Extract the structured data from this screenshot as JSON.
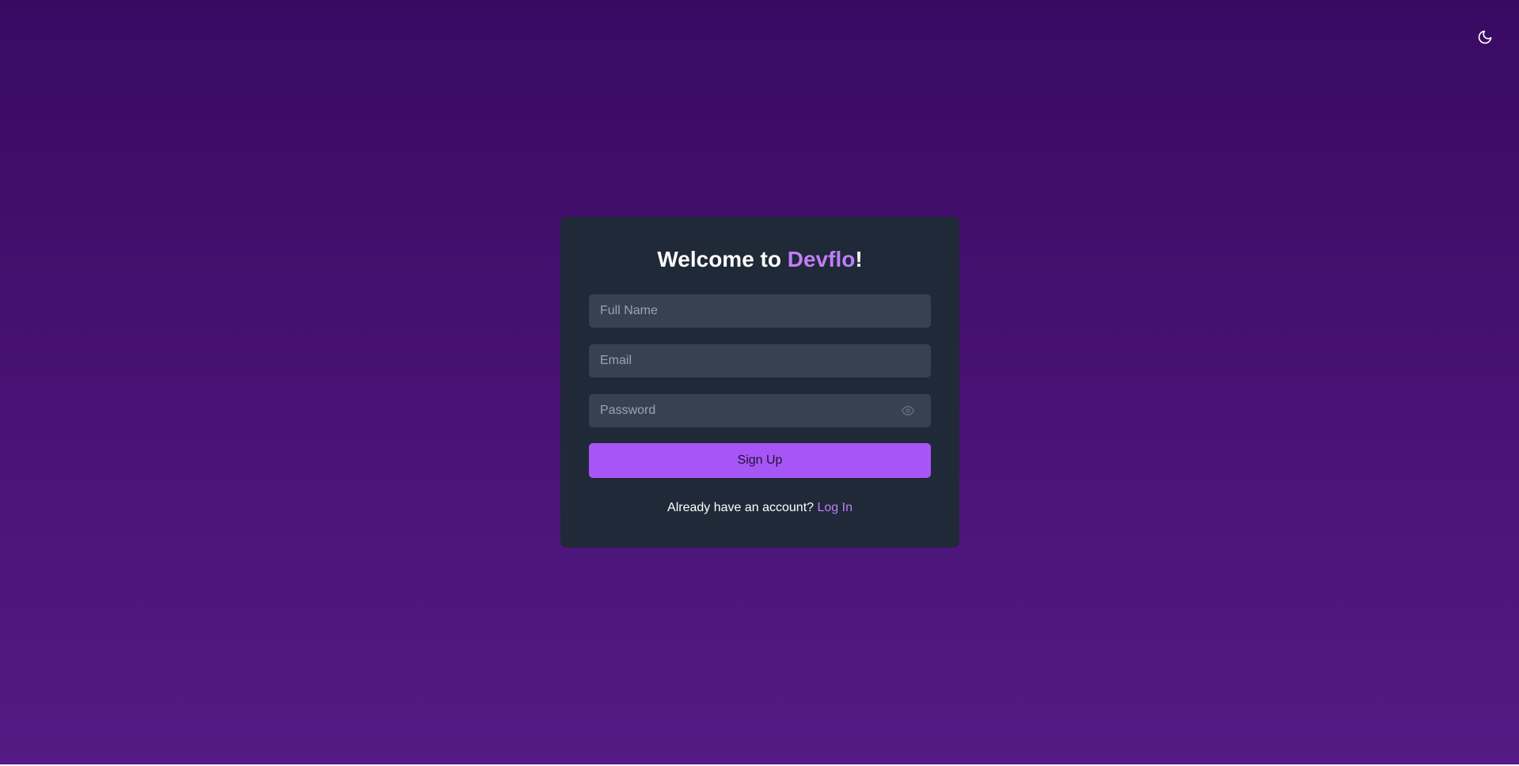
{
  "theme_toggle": {
    "icon": "moon-icon"
  },
  "signup_card": {
    "title_prefix": "Welcome to ",
    "title_brand": "Devflo",
    "title_suffix": "!",
    "full_name_placeholder": "Full Name",
    "email_placeholder": "Email",
    "password_placeholder": "Password",
    "password_toggle_icon": "eye-icon",
    "submit_label": "Sign Up",
    "footer_text": "Already have an account? ",
    "footer_link": "Log In"
  },
  "colors": {
    "background_top": "#3a0a63",
    "background_bottom": "#541a85",
    "card": "#1f2937",
    "input": "#374151",
    "accent": "#a855f7",
    "brand_text": "#c07ef7"
  }
}
